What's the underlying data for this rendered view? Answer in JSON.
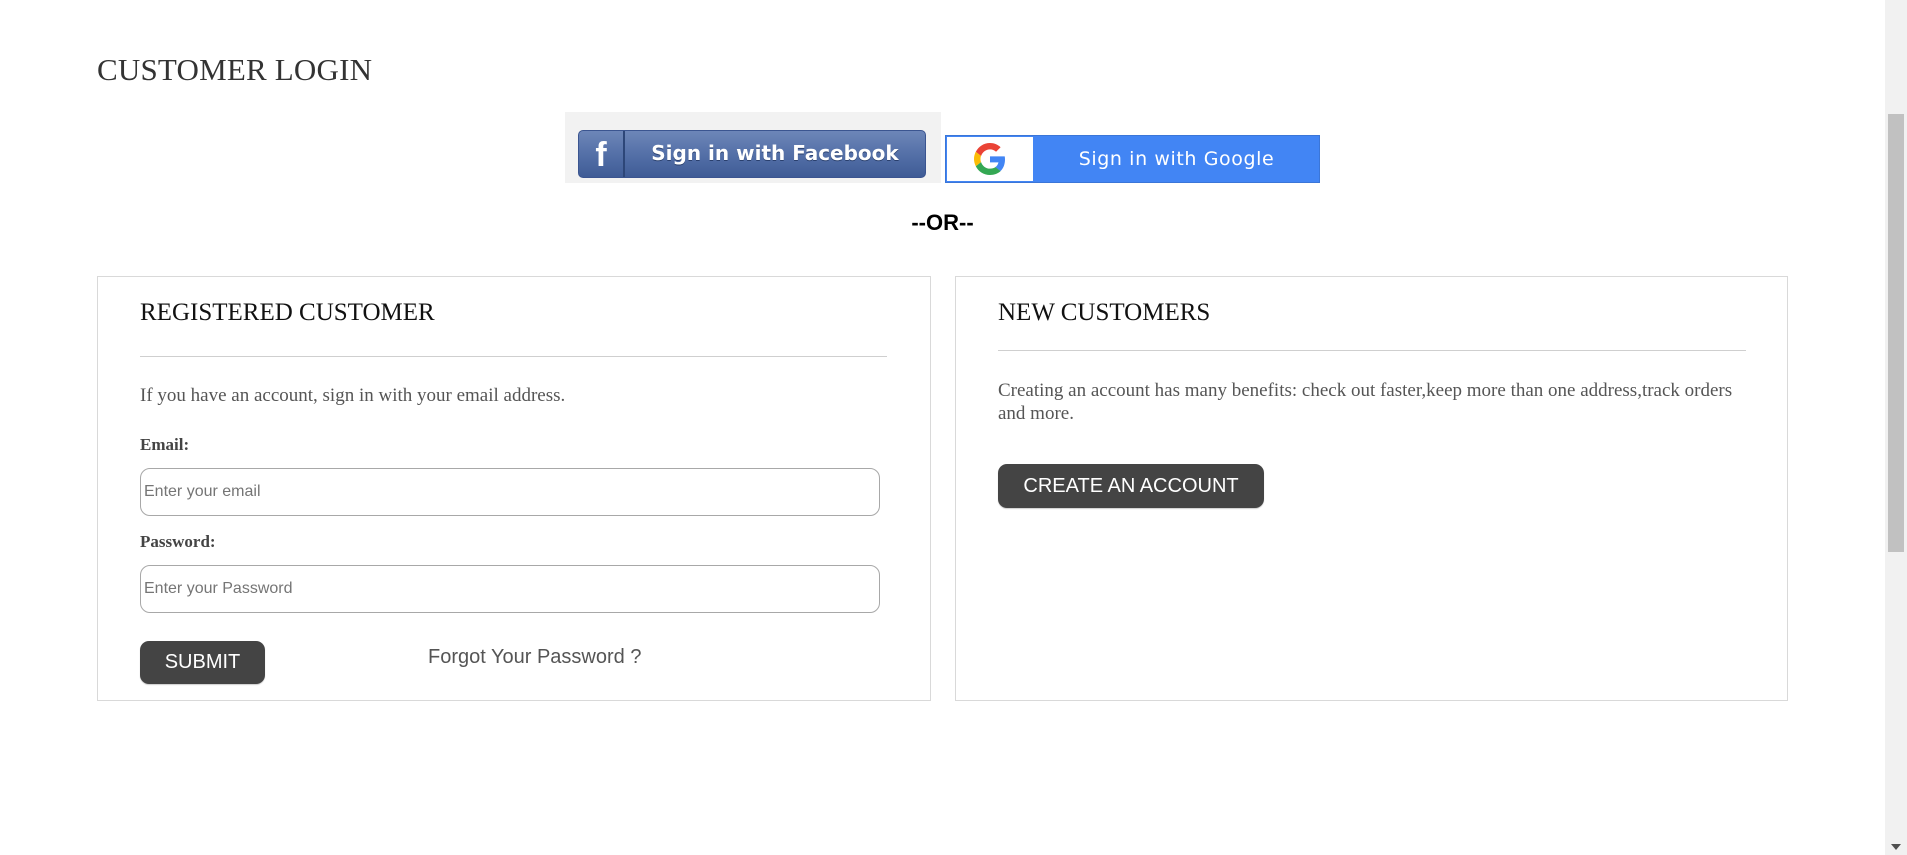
{
  "page": {
    "title": "CUSTOMER LOGIN"
  },
  "social": {
    "facebook": {
      "logo": "f",
      "label": "Sign in with Facebook"
    },
    "google": {
      "icon": "google-g-icon",
      "label": "Sign in with Google"
    },
    "or_divider": "--OR--"
  },
  "registered": {
    "title": "REGISTERED CUSTOMER",
    "intro": "If you have an account, sign in with your email address.",
    "email_label": "Email:",
    "email_placeholder": "Enter your email",
    "email_value": "",
    "password_label": "Password:",
    "password_placeholder": "Enter your Password",
    "password_value": "",
    "submit_label": "SUBMIT",
    "forgot_label": "Forgot Your Password ?"
  },
  "new_customers": {
    "title": "NEW CUSTOMERS",
    "text": "Creating an account has many benefits: check out faster,keep more than one address,track orders and more.",
    "create_label": "CREATE AN ACCOUNT"
  },
  "colors": {
    "facebook_blue": "#526ea6",
    "google_blue": "#4285f4",
    "dark_button": "#444444",
    "panel_border": "#d9d9d9"
  },
  "icons": {
    "scroll_down": "triangle-down-icon"
  }
}
